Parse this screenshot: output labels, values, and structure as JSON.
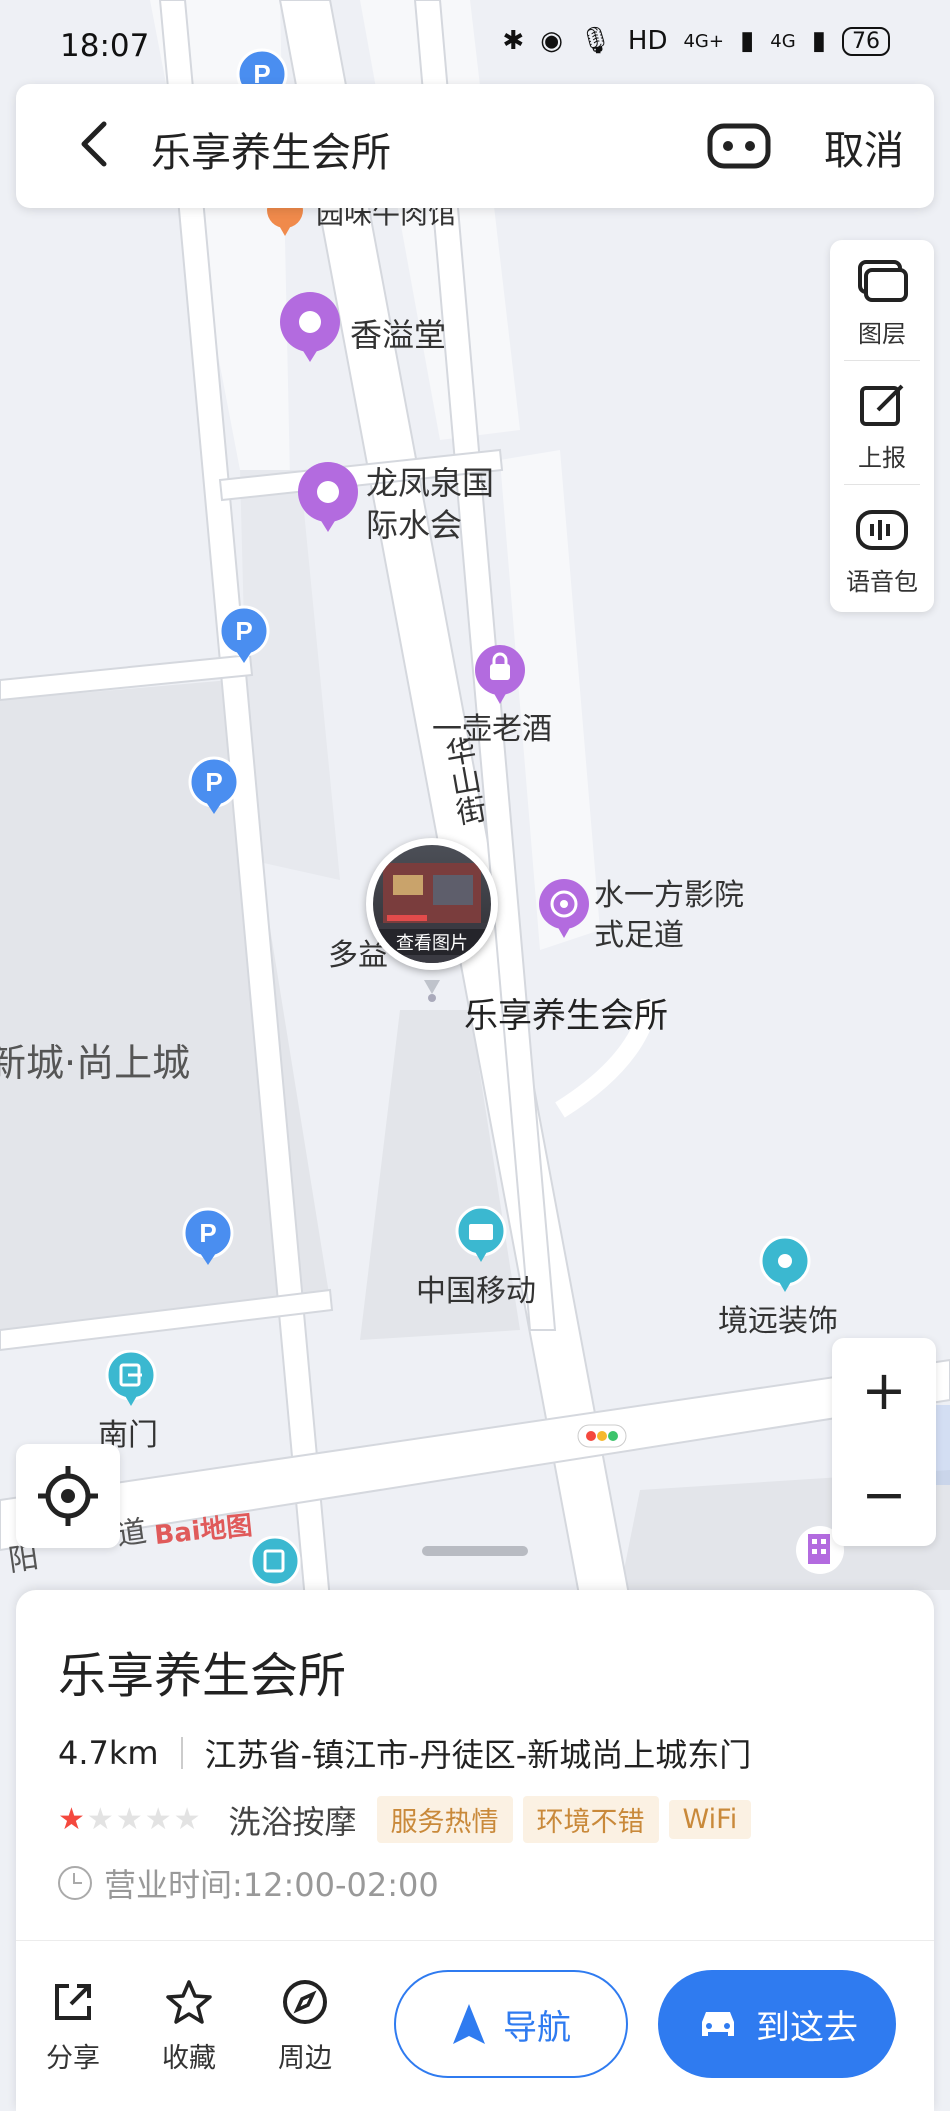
{
  "status_bar": {
    "time": "18:07",
    "network": "HD",
    "signal_1": "4G+",
    "signal_2": "4G",
    "battery": "76"
  },
  "search_bar": {
    "title": "乐享养生会所",
    "cancel_label": "取消"
  },
  "map_tools": [
    {
      "label": "图层",
      "icon": "layers-icon"
    },
    {
      "label": "上报",
      "icon": "edit-report-icon"
    },
    {
      "label": "语音包",
      "icon": "voice-pack-icon"
    }
  ],
  "zoom": {
    "in": "+",
    "out": "−"
  },
  "map_labels": {
    "niuroudian": "园味牛肉馆",
    "xiangyitang": "香溢堂",
    "longfeng_1": "龙凤泉国",
    "longfeng_2": "际水会",
    "yihu": "一壶老酒",
    "huashan": "华山街",
    "shuiyifang_1": "水一方影院",
    "shuiyifang_2": "式足道",
    "duoyi": "多益",
    "selected": "乐享养生会所",
    "photo_caption": "查看图片",
    "xincheng": "新城·尚上城",
    "yidong": "中国移动",
    "jingyuan": "境远装饰",
    "nanmen": "南门",
    "road": "道",
    "road_prefix": "阳",
    "baidu_logo": "Bai地图"
  },
  "poi": {
    "title": "乐享养生会所",
    "distance": "4.7km",
    "address": "江苏省-镇江市-丹徒区-新城尚上城东门",
    "rating": 1,
    "rating_max": 5,
    "category": "洗浴按摩",
    "tags": [
      "服务热情",
      "环境不错",
      "WiFi"
    ],
    "hours": "营业时间:12:00-02:00"
  },
  "actions": [
    {
      "label": "分享",
      "icon": "share-icon"
    },
    {
      "label": "收藏",
      "icon": "star-icon"
    },
    {
      "label": "周边",
      "icon": "compass-icon"
    }
  ],
  "nav_button": "导航",
  "go_button": "到这去",
  "colors": {
    "accent": "#2f7bf0",
    "poi_purple": "#b36bdf",
    "parking_blue": "#4a8ef0",
    "teal": "#3bb8d0",
    "star": "#f4483e",
    "tag_text": "#c9893a"
  }
}
